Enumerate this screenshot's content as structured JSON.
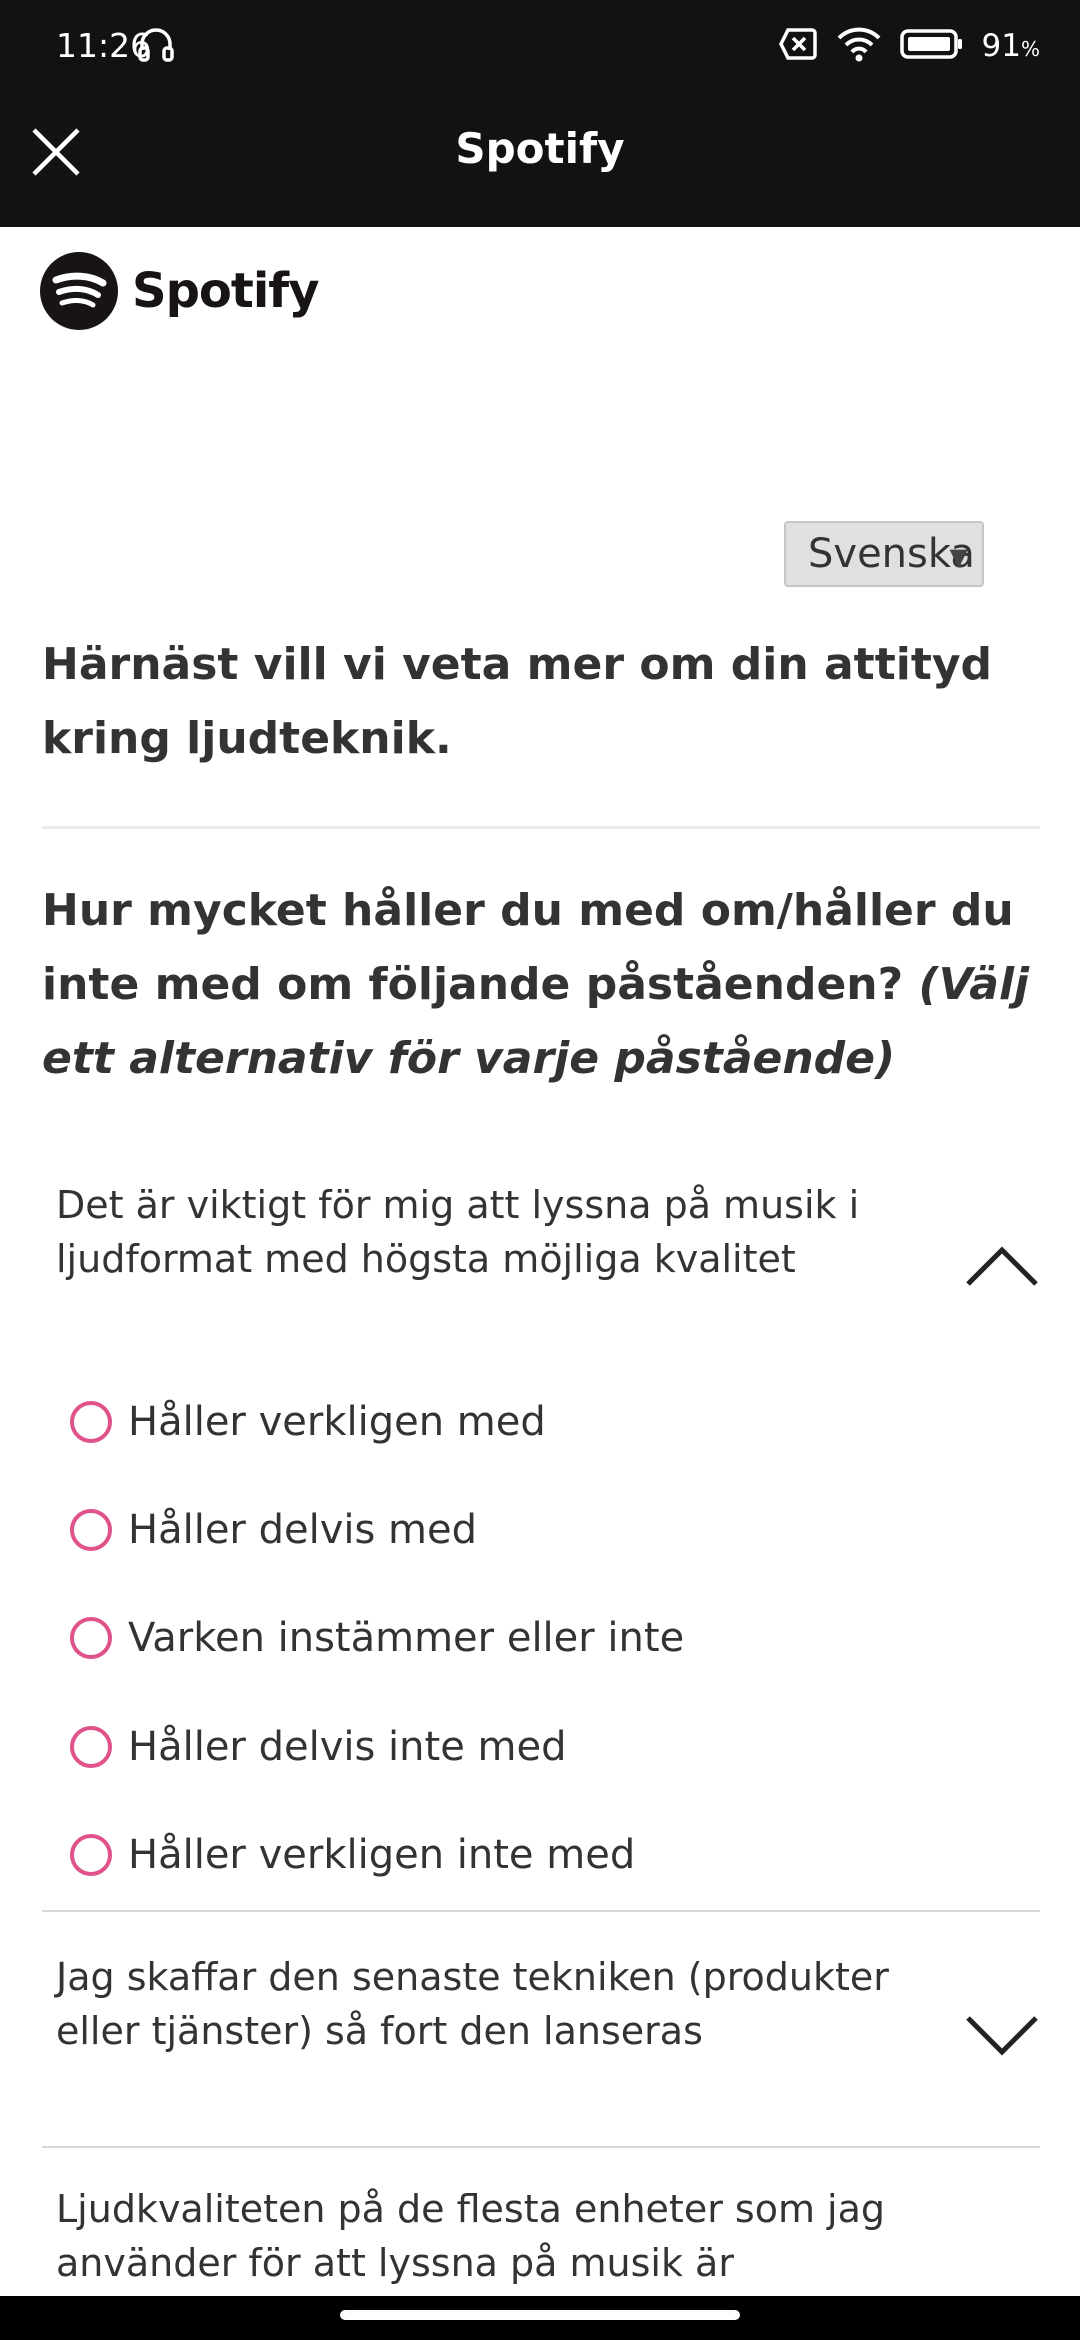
{
  "status": {
    "time": "11:26",
    "battery": "91",
    "battery_unit": "%"
  },
  "appbar": {
    "title": "Spotify"
  },
  "logo": {
    "wordmark": "Spotify"
  },
  "language": {
    "selected": "Svenska"
  },
  "survey": {
    "intro": "Härnäst vill vi veta mer om din attityd kring ljudteknik.",
    "question": "Hur mycket håller du med om/håller du inte med om följande påståenden?",
    "question_hint": "(Välj ett alternativ för varje påstående)",
    "statements": [
      {
        "text": "Det är viktigt för mig att lyssna på musik i ljudformat med högsta möjliga kvalitet",
        "expanded": true
      },
      {
        "text": "Jag skaffar den senaste tekniken (produkter eller tjänster) så fort den lanseras",
        "expanded": false
      },
      {
        "text": "Ljudkvaliteten på de flesta enheter som jag använder för att lyssna på musik är",
        "expanded": false
      }
    ],
    "options": [
      "Håller verkligen med",
      "Håller delvis med",
      "Varken instämmer eller inte",
      "Håller delvis inte med",
      "Håller verkligen inte med"
    ]
  },
  "colors": {
    "accent": "#e0528a",
    "bar": "#121212"
  }
}
